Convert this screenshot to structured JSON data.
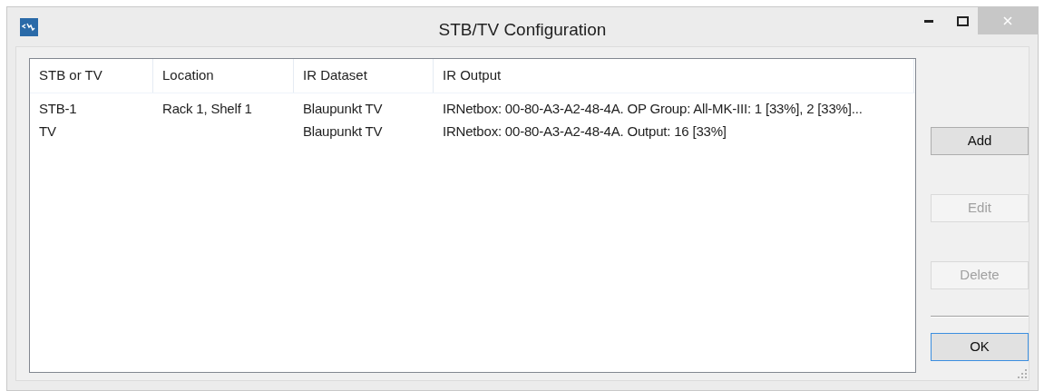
{
  "window": {
    "title": "STB/TV Configuration"
  },
  "table": {
    "columns": [
      "STB or TV",
      "Location",
      "IR Dataset",
      "IR Output"
    ],
    "rows": [
      {
        "cells": [
          "STB-1",
          "Rack 1, Shelf 1",
          "Blaupunkt TV",
          "IRNetbox: 00-80-A3-A2-48-4A. OP Group: All-MK-III: 1 [33%], 2 [33%]..."
        ]
      },
      {
        "cells": [
          "TV",
          "",
          "Blaupunkt TV",
          "IRNetbox: 00-80-A3-A2-48-4A. Output: 16 [33%]"
        ]
      }
    ]
  },
  "buttons": [
    {
      "label": "Add",
      "disabled": false,
      "default": false
    },
    {
      "label": "Edit",
      "disabled": true,
      "default": false
    },
    {
      "label": "Delete",
      "disabled": true,
      "default": false
    },
    {
      "label": "OK",
      "disabled": false,
      "default": true
    }
  ]
}
